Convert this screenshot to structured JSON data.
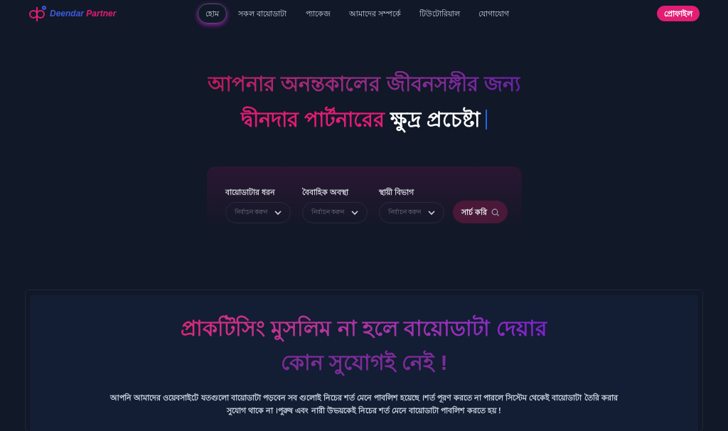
{
  "header": {
    "logo": {
      "part_1": "Deendar",
      "part_2": "Partner"
    },
    "nav": [
      {
        "label": "হোম",
        "selected": true
      },
      {
        "label": "সকল বায়োডাটা",
        "selected": false
      },
      {
        "label": "প্যাকেজ",
        "selected": false
      },
      {
        "label": "আমাদের সম্পর্কে",
        "selected": false
      },
      {
        "label": "টিউটোরিয়াল",
        "selected": false
      },
      {
        "label": "যোগাযোগ",
        "selected": false
      }
    ],
    "profile_button": "প্রোফাইল"
  },
  "hero": {
    "line_1": "আপনার অনন্তকালের জীবনসঙ্গীর জন্য",
    "line_2_colored": "দ্বীনদার পার্টনারের",
    "line_2_plain": "ক্ষুদ্র প্রচেষ্টা"
  },
  "search": {
    "filters": [
      {
        "label": "বায়োডাটার ধরন",
        "placeholder": "নির্বাচন করুন"
      },
      {
        "label": "বৈবাহিক অবস্থা",
        "placeholder": "নির্বাচন করুন"
      },
      {
        "label": "স্থায়ী বিভাগ",
        "placeholder": "নির্বাচন করুন"
      }
    ],
    "button": "সার্চ করি"
  },
  "notice": {
    "title_line_1": "প্রাকটিসিং মুসলিম না হলে বায়োডাটা দেয়ার",
    "title_line_2": "কোন সুযোগই নেই !",
    "body": "আপনি আমাদের ওয়েবসাইটে যতগুলো বায়োডাটা পড়বেন সব গুলোই নিচের শর্ত মেনে পাবলিশ হয়েছে ।শর্ত পূরণ করতে না পারলে সিস্টেম থেকেই বায়োডাটা তৈরি করার সুযোগ থাকে না ।পুরুষ এবং নারী উভয়কেই নিচের শর্ত মেনে বায়োডাটা পাবলিশ করতে হয় !"
  }
}
